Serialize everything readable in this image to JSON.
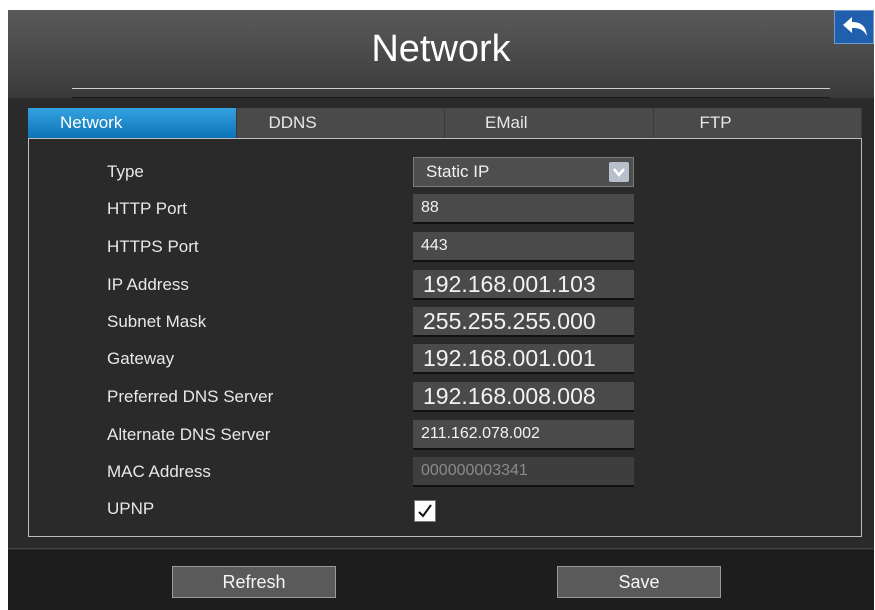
{
  "header": {
    "title": "Network"
  },
  "icons": {
    "back": "back-arrow-icon",
    "dropdown": "chevron-down-icon",
    "checkbox": "check-icon"
  },
  "tabs": [
    {
      "label": "Network",
      "active": true
    },
    {
      "label": "DDNS",
      "active": false
    },
    {
      "label": "EMail",
      "active": false
    },
    {
      "label": "FTP",
      "active": false
    }
  ],
  "form": {
    "type": {
      "label": "Type",
      "value": "Static IP"
    },
    "http_port": {
      "label": "HTTP Port",
      "value": "88"
    },
    "https_port": {
      "label": "HTTPS Port",
      "value": "443"
    },
    "ip_address": {
      "label": "IP Address",
      "value": "192.168.001.103"
    },
    "subnet_mask": {
      "label": "Subnet Mask",
      "value": "255.255.255.000"
    },
    "gateway": {
      "label": "Gateway",
      "value": "192.168.001.001"
    },
    "preferred_dns": {
      "label": "Preferred DNS Server",
      "value": "192.168.008.008"
    },
    "alternate_dns": {
      "label": "Alternate DNS Server",
      "value": "211.162.078.002"
    },
    "mac_address": {
      "label": "MAC Address",
      "value": "000000003341"
    },
    "upnp": {
      "label": "UPNP",
      "checked": true
    }
  },
  "footer": {
    "refresh_label": "Refresh",
    "save_label": "Save"
  },
  "colors": {
    "accent": "#1a88cf",
    "back_button": "#1f5fae"
  }
}
